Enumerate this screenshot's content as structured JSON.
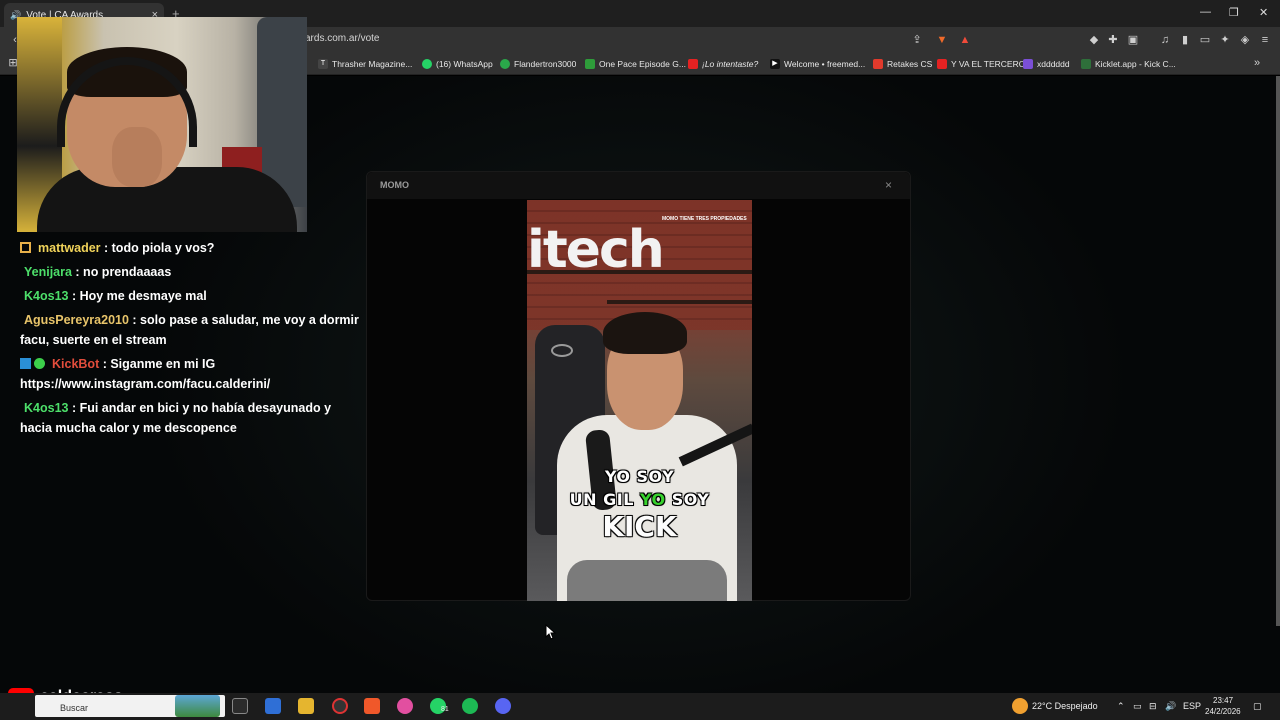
{
  "browser": {
    "tab": {
      "title": "Vote | CA Awards",
      "close": "×"
    },
    "new_tab": "+",
    "url": "ards.com.ar/vote",
    "window": {
      "minimize": "—",
      "restore": "❐",
      "close": "✕"
    },
    "bookmarks": [
      {
        "label": "Thrasher Magazine...",
        "color": "#444444"
      },
      {
        "label": "(16) WhatsApp",
        "color": "#25d366"
      },
      {
        "label": "Flandertron3000",
        "color": "#2aa84a"
      },
      {
        "label": "One Pace Episode G...",
        "color": "#2e9c3a"
      },
      {
        "label": "¡Lo intentaste?",
        "color": "#e52222"
      },
      {
        "label": "Welcome • freemed...",
        "color": "#111111"
      },
      {
        "label": "Retakes CS",
        "color": "#e03a2c"
      },
      {
        "label": "Y VA EL TERCERO",
        "color": "#e52222"
      },
      {
        "label": "xdddddd",
        "color": "#7b4fd6"
      },
      {
        "label": "Kicklet.app - Kick C...",
        "color": "#2e6f3a"
      }
    ]
  },
  "modal": {
    "title": "MOMO",
    "close": "×",
    "video": {
      "bg_text": "itech",
      "top_tag": "MOMO TIENE TRES PROPIEDADES",
      "caption_line1": "YO SOY",
      "caption_line2_a": "UN GIL",
      "caption_line2_b": "YO",
      "caption_line2_c": "SOY",
      "caption_line3": "KICK"
    }
  },
  "chat": {
    "messages": [
      {
        "user": "mattwader",
        "user_color": "#f0d35a",
        "text": ": todo piola y vos?",
        "badge": true
      },
      {
        "user": "Yenijara",
        "user_color": "#4ddf6a",
        "text": ": no prendaaaas"
      },
      {
        "user": "K4os13",
        "user_color": "#4ddf6a",
        "text": ": Hoy me desmaye mal"
      },
      {
        "user": "AgusPereyra2010",
        "user_color": "#e8c46a",
        "text": ": solo pase a saludar, me voy a dormir facu, suerte en el stream"
      },
      {
        "user": "KickBot",
        "user_color": "#e24d3c",
        "text": ": Siganme en mi IG https://www.instagram.com/facu.calderini/",
        "bot": true
      },
      {
        "user": "K4os13",
        "user_color": "#4ddf6a",
        "text": ": Fui andar en bici y no había desayunado y hacia mucha calor y me descopence"
      }
    ]
  },
  "overlay": {
    "channel_name": "caldeerass"
  },
  "taskbar": {
    "search_placeholder": "Buscar",
    "weather": "22°C Despejado",
    "language": "ESP",
    "time": "23:47",
    "date": "24/2/2026",
    "whatsapp_badge": "81"
  }
}
